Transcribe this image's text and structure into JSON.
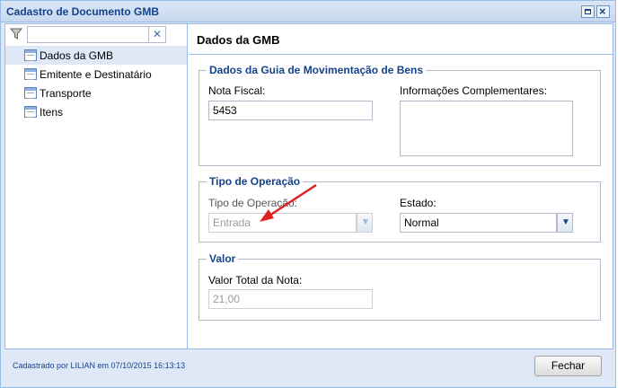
{
  "window": {
    "title": "Cadastro de Documento GMB"
  },
  "sidebar": {
    "filter": {
      "value": ""
    },
    "items": [
      {
        "label": "Dados da GMB",
        "selected": true
      },
      {
        "label": "Emitente e Destinatário",
        "selected": false
      },
      {
        "label": "Transporte",
        "selected": false
      },
      {
        "label": "Itens",
        "selected": false
      }
    ]
  },
  "main": {
    "title": "Dados da GMB",
    "section_guia": {
      "legend": "Dados da Guia de Movimentação de Bens",
      "nota_fiscal_label": "Nota Fiscal:",
      "nota_fiscal_value": "5453",
      "info_label": "Informações Complementares:",
      "info_value": ""
    },
    "section_operacao": {
      "legend": "Tipo de Operação",
      "tipo_label": "Tipo de Operação:",
      "tipo_value": "Entrada",
      "estado_label": "Estado:",
      "estado_value": "Normal"
    },
    "section_valor": {
      "legend": "Valor",
      "total_label": "Valor Total da Nota:",
      "total_value": "21,00"
    }
  },
  "footer": {
    "status": "Cadastrado por LILIAN em 07/10/2015 16:13:13",
    "close_label": "Fechar"
  },
  "colors": {
    "header_blue": "#15428b",
    "border_blue": "#99bbe8",
    "selection": "#dfe8f6",
    "annotation_arrow": "#e02020"
  }
}
